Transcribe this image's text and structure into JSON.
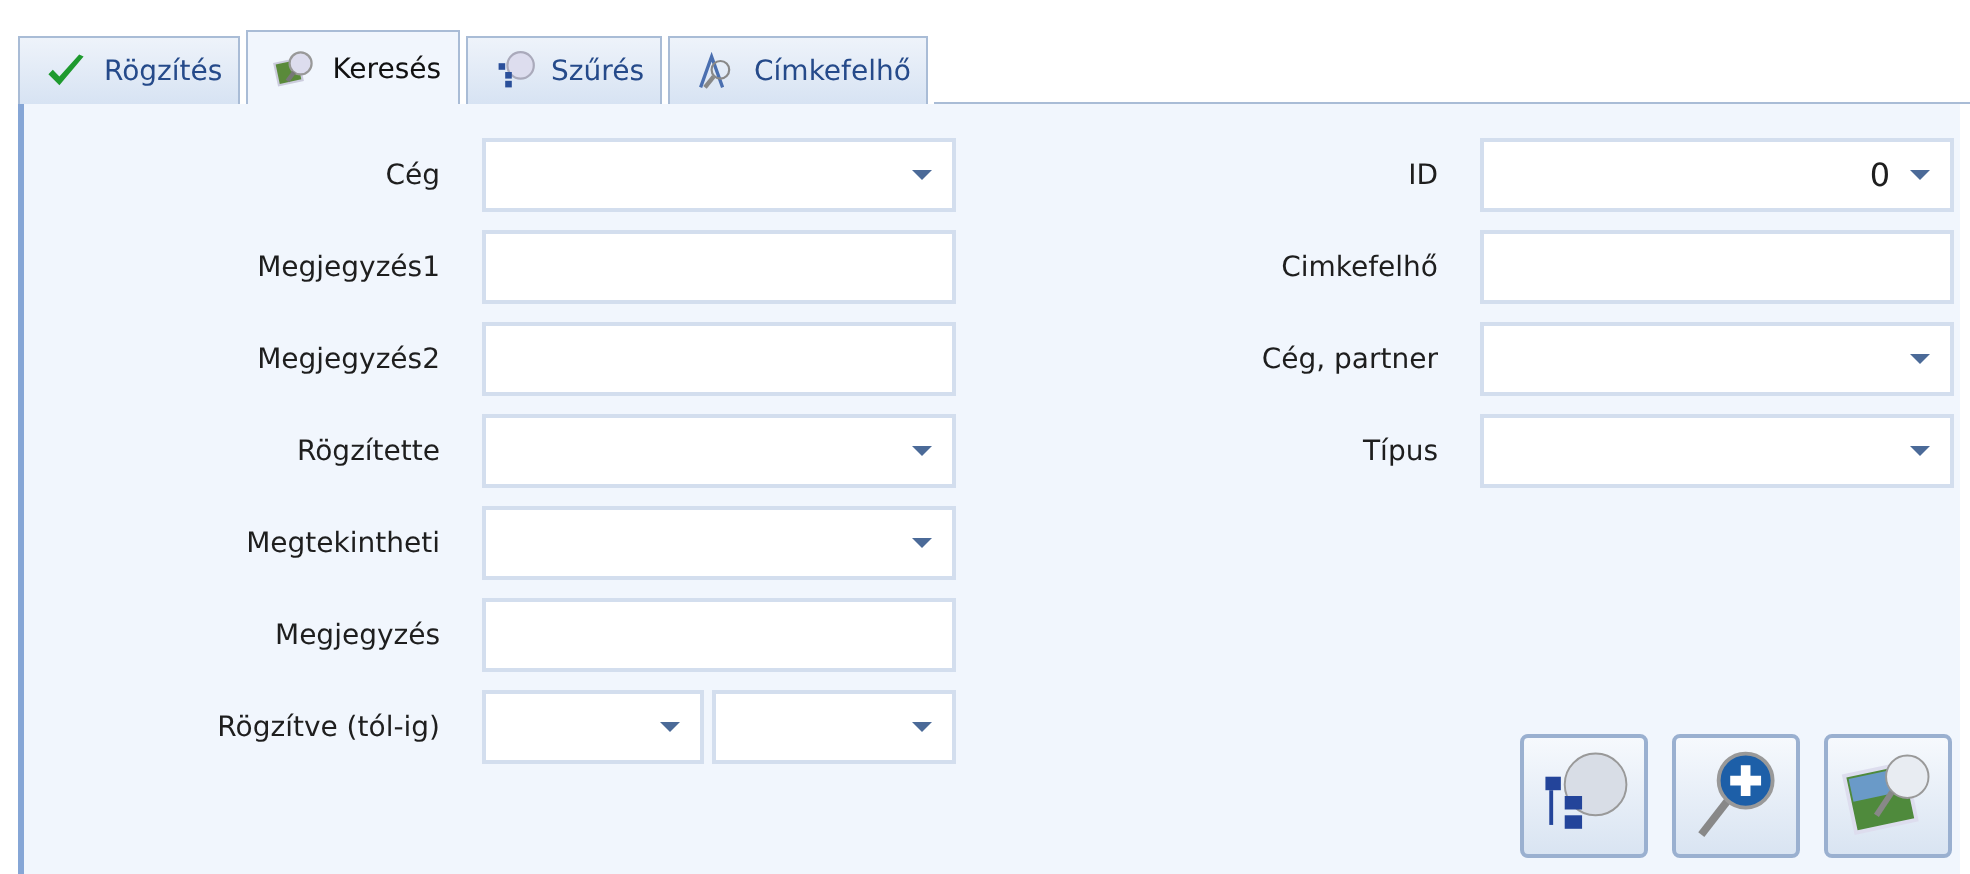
{
  "tabs": [
    {
      "label": "Rögzítés",
      "selected": false
    },
    {
      "label": "Keresés",
      "selected": true
    },
    {
      "label": "Szűrés",
      "selected": false
    },
    {
      "label": "Címkefelhő",
      "selected": false
    }
  ],
  "left_fields": [
    {
      "label": "Cég",
      "kind": "dropdown"
    },
    {
      "label": "Megjegyzés1",
      "kind": "text"
    },
    {
      "label": "Megjegyzés2",
      "kind": "text"
    },
    {
      "label": "Rögzítette",
      "kind": "dropdown"
    },
    {
      "label": "Megtekintheti",
      "kind": "dropdown"
    },
    {
      "label": "Megjegyzés",
      "kind": "text"
    },
    {
      "label": "Rögzítve (tól-ig)",
      "kind": "range"
    }
  ],
  "right_fields": [
    {
      "label": "ID",
      "kind": "dropdown",
      "value": "0"
    },
    {
      "label": "Cimkefelhő",
      "kind": "text"
    },
    {
      "label": "Cég, partner",
      "kind": "dropdown"
    },
    {
      "label": "Típus",
      "kind": "dropdown"
    }
  ]
}
